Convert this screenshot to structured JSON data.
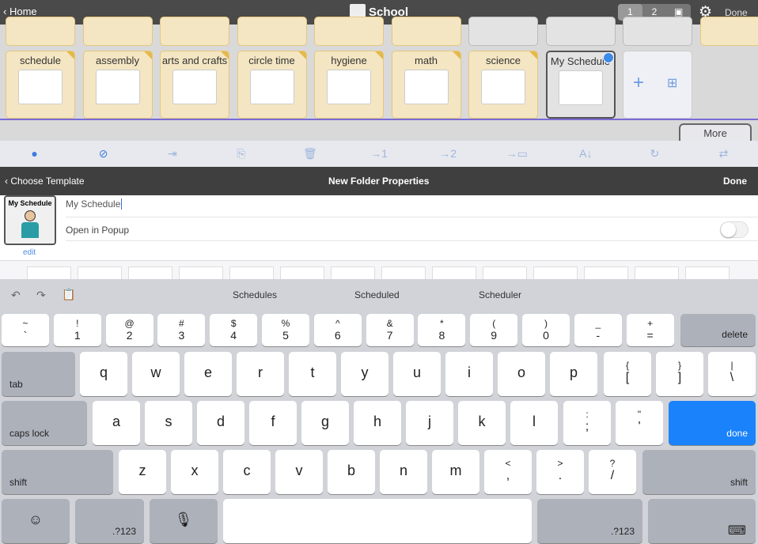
{
  "header": {
    "back_label": "Home",
    "title": "School",
    "pages": [
      "1",
      "2"
    ],
    "done_label": "Done"
  },
  "grid": {
    "top_row_count": 10,
    "tiles": [
      {
        "label": "schedule",
        "color": "yellow"
      },
      {
        "label": "assembly",
        "color": "yellow"
      },
      {
        "label": "arts and crafts",
        "color": "yellow"
      },
      {
        "label": "circle time",
        "color": "yellow"
      },
      {
        "label": "hygiene",
        "color": "yellow"
      },
      {
        "label": "math",
        "color": "yellow"
      },
      {
        "label": "science",
        "color": "yellow"
      },
      {
        "label": "My Schedule",
        "color": "gray",
        "selected": true
      }
    ],
    "more_label": "More"
  },
  "toolbar": {
    "icons": [
      "check-circle-icon",
      "deselect-icon",
      "import-icon",
      "copy-icon",
      "trash-icon",
      "move-page1-icon",
      "move-page2-icon",
      "move-folder-icon",
      "sort-icon",
      "refresh-icon",
      "swap-icon"
    ]
  },
  "panel": {
    "back_label": "Choose Template",
    "title": "New Folder Properties",
    "done_label": "Done",
    "thumb_label": "My Schedule",
    "edit_label": "edit",
    "name_value": "My Schedule",
    "popup_label": "Open in Popup",
    "popup_on": false
  },
  "keyboard": {
    "suggestions": [
      "Schedules",
      "Scheduled",
      "Scheduler"
    ],
    "row1": [
      [
        "~",
        "`"
      ],
      [
        "!",
        "1"
      ],
      [
        "@",
        "2"
      ],
      [
        "#",
        "3"
      ],
      [
        "$",
        "4"
      ],
      [
        "%",
        "5"
      ],
      [
        "^",
        "6"
      ],
      [
        "&",
        "7"
      ],
      [
        "*",
        "8"
      ],
      [
        "(",
        "9"
      ],
      [
        ")",
        "0"
      ],
      [
        "_",
        "-"
      ],
      [
        "+",
        "="
      ]
    ],
    "delete": "delete",
    "row2": [
      "q",
      "w",
      "e",
      "r",
      "t",
      "y",
      "u",
      "i",
      "o",
      "p"
    ],
    "row2b": [
      [
        "{",
        "["
      ],
      [
        "}",
        "]"
      ],
      [
        "|",
        "\\"
      ]
    ],
    "tab": "tab",
    "row3": [
      "a",
      "s",
      "d",
      "f",
      "g",
      "h",
      "j",
      "k",
      "l"
    ],
    "row3b": [
      [
        ":",
        ";"
      ],
      [
        "\"",
        "'"
      ]
    ],
    "caps": "caps lock",
    "done": "done",
    "row4": [
      "z",
      "x",
      "c",
      "v",
      "b",
      "n",
      "m"
    ],
    "row4b": [
      [
        "<",
        ","
      ],
      [
        ">",
        "."
      ],
      [
        "?",
        "/"
      ]
    ],
    "shift": "shift",
    "numkey": ".?123",
    "accent": "#1a82fb"
  }
}
